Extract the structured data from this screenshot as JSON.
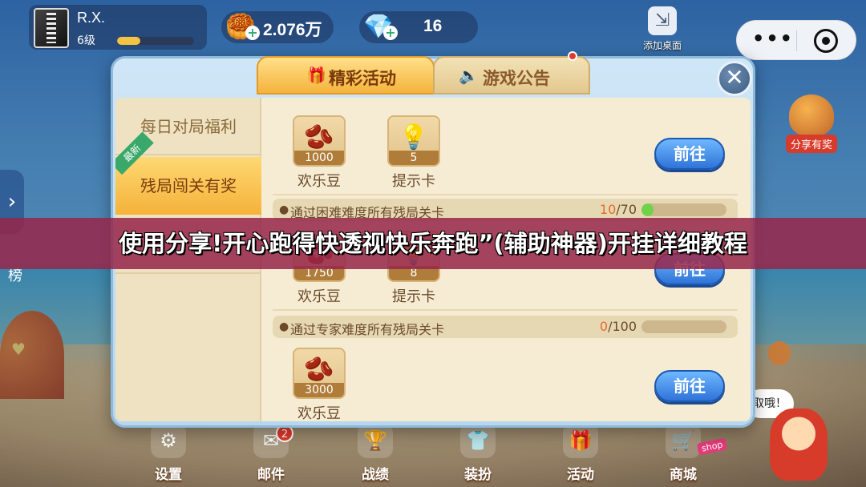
{
  "profile": {
    "name": "R.X.",
    "level": "6级",
    "xp_progress": 0.3
  },
  "resources": {
    "gold": "2.076万",
    "gems": "16"
  },
  "top_actions": {
    "add_desktop_label": "添加桌面",
    "more_label": "•••"
  },
  "side": {
    "rank_label": "榜",
    "share_label": "分享有奖",
    "bubble_text": "取哦！"
  },
  "tabs": [
    {
      "label": "精彩活动",
      "icon": "gift-icon",
      "active": true
    },
    {
      "label": "游戏公告",
      "icon": "speaker-icon",
      "active": false
    }
  ],
  "menu": [
    {
      "label": "每日对局福利"
    },
    {
      "label": "残局闯关有奖",
      "badge": "最新"
    },
    {
      "label": ""
    }
  ],
  "tasks": [
    {
      "name": "",
      "rewards": [
        {
          "icon": "bean-icon",
          "qty": "1000",
          "name": "欢乐豆"
        },
        {
          "icon": "hint-card-icon",
          "qty": "5",
          "name": "提示卡"
        }
      ],
      "button": "前往"
    },
    {
      "name": "通过困难难度所有残局关卡",
      "progress_done": "10",
      "progress_total": "/70",
      "progress_fraction": 0.143,
      "rewards": [
        {
          "icon": "bean-icon",
          "qty": "1750",
          "name": "欢乐豆"
        },
        {
          "icon": "hint-card-icon",
          "qty": "8",
          "name": "提示卡"
        }
      ],
      "button": "前往"
    },
    {
      "name": "通过专家难度所有残局关卡",
      "progress_done": "0",
      "progress_total": "/100",
      "progress_fraction": 0.0,
      "rewards": [
        {
          "icon": "bean-icon",
          "qty": "3000",
          "name": "欢乐豆"
        }
      ],
      "button": "前往"
    }
  ],
  "bottom_nav": [
    {
      "label": "设置",
      "icon": "gear-icon"
    },
    {
      "label": "邮件",
      "icon": "mail-icon",
      "badge": "2"
    },
    {
      "label": "战绩",
      "icon": "trophy-icon"
    },
    {
      "label": "装扮",
      "icon": "shirt-icon"
    },
    {
      "label": "活动",
      "icon": "gift-icon"
    },
    {
      "label": "商城",
      "icon": "cart-icon",
      "tag": "shop"
    }
  ],
  "banner": {
    "title": "使用分享!开心跑得快透视快乐奔跑”(辅助神器)开挂详细教程"
  },
  "colors": {
    "banner": "#96264a",
    "tab_active": "#f4b43c",
    "button": "#2f73d8"
  }
}
